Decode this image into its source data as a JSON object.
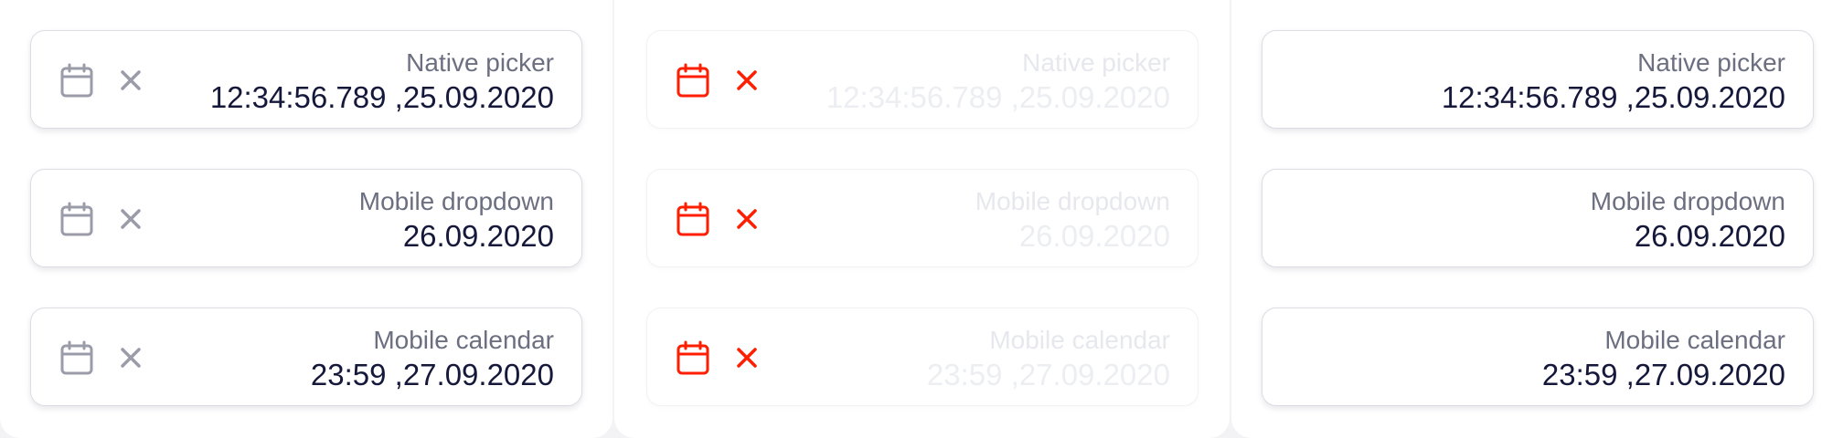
{
  "colors": {
    "icon_default": "#9b9caa",
    "icon_error": "#ff1e00",
    "label": "#6b6f80",
    "value": "#15183a",
    "label_disabled": "#e7e8ee",
    "value_disabled": "#eceef2"
  },
  "icons": {
    "calendar": "calendar-icon",
    "clear": "close-icon"
  },
  "columns": [
    {
      "variant": "default",
      "fields": [
        {
          "label": "Native picker",
          "value": "12:34:56.789 ,25.09.2020"
        },
        {
          "label": "Mobile dropdown",
          "value": "26.09.2020"
        },
        {
          "label": "Mobile calendar",
          "value": "23:59 ,27.09.2020"
        }
      ]
    },
    {
      "variant": "error-disabled",
      "fields": [
        {
          "label": "Native picker",
          "value": "12:34:56.789 ,25.09.2020"
        },
        {
          "label": "Mobile dropdown",
          "value": "26.09.2020"
        },
        {
          "label": "Mobile calendar",
          "value": "23:59 ,27.09.2020"
        }
      ]
    },
    {
      "variant": "readonly",
      "fields": [
        {
          "label": "Native picker",
          "value": "12:34:56.789 ,25.09.2020"
        },
        {
          "label": "Mobile dropdown",
          "value": "26.09.2020"
        },
        {
          "label": "Mobile calendar",
          "value": "23:59 ,27.09.2020"
        }
      ]
    }
  ]
}
